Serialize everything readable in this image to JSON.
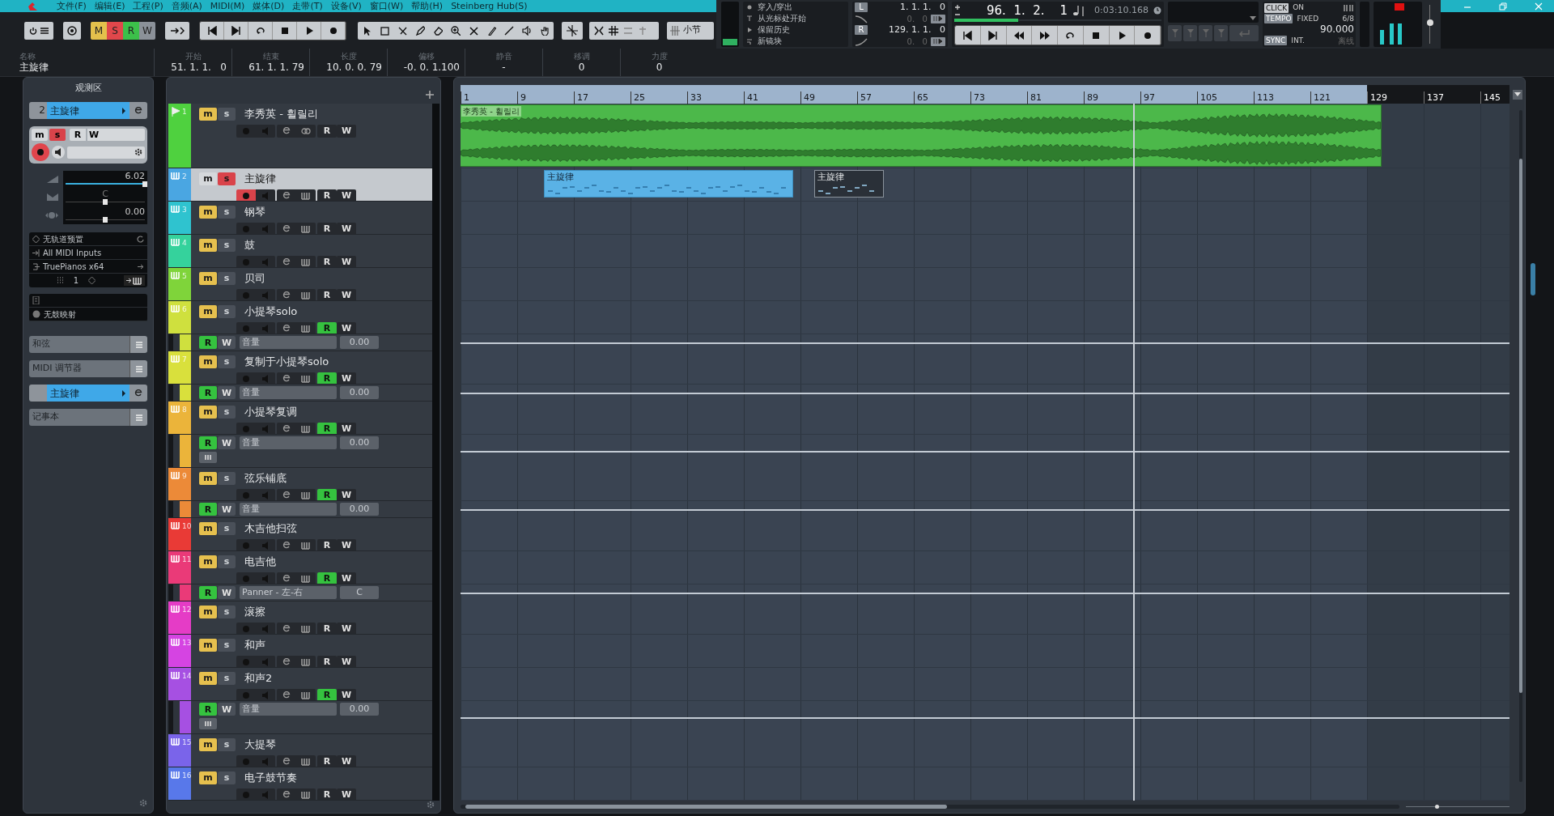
{
  "menu": [
    "文件(F)",
    "编辑(E)",
    "工程(P)",
    "音频(A)",
    "MIDI(M)",
    "媒体(D)",
    "走带(T)",
    "设备(V)",
    "窗口(W)",
    "帮助(H)",
    "Steinberg Hub(S)"
  ],
  "toolbar": {
    "automation_modes": [
      {
        "label": "M",
        "color": "#e3c04c"
      },
      {
        "label": "S",
        "color": "#e0474b"
      },
      {
        "label": "R",
        "color": "#3cc04a"
      },
      {
        "label": "W",
        "color": "#8b9199"
      }
    ],
    "grid_type": "小节"
  },
  "info_line": [
    {
      "label": "名称",
      "value": "主旋律"
    },
    {
      "label": "开始",
      "value": "51. 1. 1.   0"
    },
    {
      "label": "结束",
      "value": "61. 1. 1. 79"
    },
    {
      "label": "长度",
      "value": "10. 0. 0. 79"
    },
    {
      "label": "偏移",
      "value": "-0. 0. 1.100"
    },
    {
      "label": "静音",
      "value": "-"
    },
    {
      "label": "移调",
      "value": "0"
    },
    {
      "label": "力度",
      "value": "0"
    }
  ],
  "transport": {
    "punch": [
      "穿入/穿出",
      "从光标处开始",
      "保留历史",
      "新镜块"
    ],
    "left_locator": {
      "label": "L",
      "position": "1. 1. 1.   0",
      "offset": "0.   0"
    },
    "right_locator": {
      "label": "R",
      "position": "129. 1. 1.   0",
      "offset": "0.   0"
    },
    "position": "96.  1.  2.    1",
    "time": "0:03:10.168",
    "position_bar": {
      "level": 0.31
    },
    "click": {
      "label": "CLICK",
      "value": "ON"
    },
    "tempo": {
      "label": "TEMPO",
      "mode": "FIXED",
      "signature": "6/8",
      "bpm": "90.000"
    },
    "sync": {
      "label": "SYNC",
      "value": "INT.",
      "status": "离线"
    },
    "output_volume": {
      "level": 0.55
    }
  },
  "zoom_slider": {
    "level": 0.3
  },
  "inspector": {
    "title": "观测区",
    "track_number": "2",
    "track_name": "主旋律",
    "buttons": {
      "mute": "m",
      "solo": "s",
      "read": "R",
      "write": "W"
    },
    "muted": false,
    "solo": true,
    "record_armed": true,
    "volume": {
      "value": "6.02",
      "level": 1.0
    },
    "pan": {
      "value": "C",
      "level": 0.5
    },
    "delay": {
      "value": "0.00",
      "level": 0.5
    },
    "preset": "无轨道预置",
    "input": "All MIDI Inputs",
    "output": "TruePianos x64",
    "channel": "1",
    "drum_map": "无鼓映射",
    "sections": [
      {
        "label": "和弦",
        "kind": "section"
      },
      {
        "label": "MIDI 调节器",
        "kind": "section"
      },
      {
        "label": "主旋律",
        "kind": "track"
      },
      {
        "label": "记事本",
        "kind": "section"
      }
    ]
  },
  "tracks": [
    {
      "number": "1",
      "name": "李秀英 - 휠릴리",
      "kind": "audio",
      "color": "#4fd13f",
      "selected": false,
      "muted": true,
      "solo": false,
      "record_armed": false,
      "read": false,
      "buttons": {
        "mute": "m",
        "solo": "s",
        "read": "R",
        "write": "W"
      },
      "events": [
        {
          "label": "李秀英 - 휠릴리",
          "selected": false
        }
      ]
    },
    {
      "number": "2",
      "name": "主旋律",
      "kind": "midi",
      "color": "#4aa6e2",
      "selected": true,
      "muted": false,
      "solo": true,
      "record_armed": true,
      "read": false,
      "buttons": {
        "mute": "m",
        "solo": "s",
        "read": "R",
        "write": "W"
      },
      "events": [
        {
          "label": "主旋律",
          "selected": false
        },
        {
          "label": "主旋律",
          "selected": true
        }
      ]
    },
    {
      "number": "3",
      "name": "钢琴",
      "kind": "midi",
      "color": "#2fc3cf",
      "selected": false,
      "muted": true,
      "solo": false,
      "record_armed": false,
      "read": false,
      "buttons": {
        "mute": "m",
        "solo": "s",
        "read": "R",
        "write": "W"
      }
    },
    {
      "number": "4",
      "name": "鼓",
      "kind": "midi",
      "color": "#35d29c",
      "selected": false,
      "muted": true,
      "solo": false,
      "record_armed": false,
      "read": false,
      "buttons": {
        "mute": "m",
        "solo": "s",
        "read": "R",
        "write": "W"
      }
    },
    {
      "number": "5",
      "name": "贝司",
      "kind": "midi",
      "color": "#7fd43a",
      "selected": false,
      "muted": true,
      "solo": false,
      "record_armed": false,
      "read": false,
      "buttons": {
        "mute": "m",
        "solo": "s",
        "read": "R",
        "write": "W"
      }
    },
    {
      "number": "6",
      "name": "小提琴solo",
      "kind": "midi",
      "color": "#cfe03e",
      "selected": false,
      "muted": true,
      "solo": false,
      "record_armed": false,
      "read": true,
      "buttons": {
        "mute": "m",
        "solo": "s",
        "read": "R",
        "write": "W"
      },
      "lanes": [
        {
          "parameter": "音量",
          "value": "0.00",
          "read": true,
          "extra": false,
          "buttons": {
            "read": "R",
            "write": "W"
          }
        }
      ]
    },
    {
      "number": "7",
      "name": "复制于小提琴solo",
      "kind": "midi",
      "color": "#d9e03c",
      "selected": false,
      "muted": true,
      "solo": false,
      "record_armed": false,
      "read": true,
      "buttons": {
        "mute": "m",
        "solo": "s",
        "read": "R",
        "write": "W"
      },
      "lanes": [
        {
          "parameter": "音量",
          "value": "0.00",
          "read": true,
          "extra": false,
          "buttons": {
            "read": "R",
            "write": "W"
          }
        }
      ]
    },
    {
      "number": "8",
      "name": "小提琴复调",
      "kind": "midi",
      "color": "#ebb43a",
      "selected": false,
      "muted": true,
      "solo": false,
      "record_armed": false,
      "read": true,
      "buttons": {
        "mute": "m",
        "solo": "s",
        "read": "R",
        "write": "W"
      },
      "lanes": [
        {
          "parameter": "音量",
          "value": "0.00",
          "read": true,
          "extra": true,
          "buttons": {
            "read": "R",
            "write": "W"
          }
        }
      ]
    },
    {
      "number": "9",
      "name": "弦乐铺底",
      "kind": "midi",
      "color": "#ec8a38",
      "selected": false,
      "muted": true,
      "solo": false,
      "record_armed": false,
      "read": true,
      "buttons": {
        "mute": "m",
        "solo": "s",
        "read": "R",
        "write": "W"
      },
      "lanes": [
        {
          "parameter": "音量",
          "value": "0.00",
          "read": true,
          "extra": false,
          "buttons": {
            "read": "R",
            "write": "W"
          }
        }
      ]
    },
    {
      "number": "10",
      "name": "木吉他扫弦",
      "kind": "midi",
      "color": "#e93a36",
      "selected": false,
      "muted": true,
      "solo": false,
      "record_armed": false,
      "read": false,
      "buttons": {
        "mute": "m",
        "solo": "s",
        "read": "R",
        "write": "W"
      }
    },
    {
      "number": "11",
      "name": "电吉他",
      "kind": "midi",
      "color": "#ea3a78",
      "selected": false,
      "muted": true,
      "solo": false,
      "record_armed": false,
      "read": true,
      "buttons": {
        "mute": "m",
        "solo": "s",
        "read": "R",
        "write": "W"
      },
      "lanes": [
        {
          "parameter": "Panner - 左-右",
          "value": "C",
          "read": true,
          "extra": false,
          "buttons": {
            "read": "R",
            "write": "W"
          }
        }
      ]
    },
    {
      "number": "12",
      "name": "滚擦",
      "kind": "midi",
      "color": "#e53cc6",
      "selected": false,
      "muted": true,
      "solo": false,
      "record_armed": false,
      "read": false,
      "buttons": {
        "mute": "m",
        "solo": "s",
        "read": "R",
        "write": "W"
      }
    },
    {
      "number": "13",
      "name": "和声",
      "kind": "midi",
      "color": "#d544e2",
      "selected": false,
      "muted": true,
      "solo": false,
      "record_armed": false,
      "read": false,
      "buttons": {
        "mute": "m",
        "solo": "s",
        "read": "R",
        "write": "W"
      }
    },
    {
      "number": "14",
      "name": "和声2",
      "kind": "midi",
      "color": "#a650e2",
      "selected": false,
      "muted": true,
      "solo": false,
      "record_armed": false,
      "read": true,
      "buttons": {
        "mute": "m",
        "solo": "s",
        "read": "R",
        "write": "W"
      },
      "lanes": [
        {
          "parameter": "音量",
          "value": "0.00",
          "read": true,
          "extra": true,
          "buttons": {
            "read": "R",
            "write": "W"
          }
        }
      ]
    },
    {
      "number": "15",
      "name": "大提琴",
      "kind": "midi",
      "color": "#7a64ea",
      "selected": false,
      "muted": true,
      "solo": false,
      "record_armed": false,
      "read": false,
      "buttons": {
        "mute": "m",
        "solo": "s",
        "read": "R",
        "write": "W"
      }
    },
    {
      "number": "16",
      "name": "电子鼓节奏",
      "kind": "midi",
      "color": "#5878ea",
      "selected": false,
      "muted": true,
      "solo": false,
      "record_armed": false,
      "read": false,
      "buttons": {
        "mute": "m",
        "solo": "s",
        "read": "R",
        "write": "W"
      }
    }
  ],
  "ruler": [
    "1",
    "9",
    "17",
    "25",
    "33",
    "41",
    "49",
    "57",
    "65",
    "73",
    "81",
    "89",
    "97",
    "105",
    "113",
    "121",
    "129",
    "137",
    "145"
  ]
}
